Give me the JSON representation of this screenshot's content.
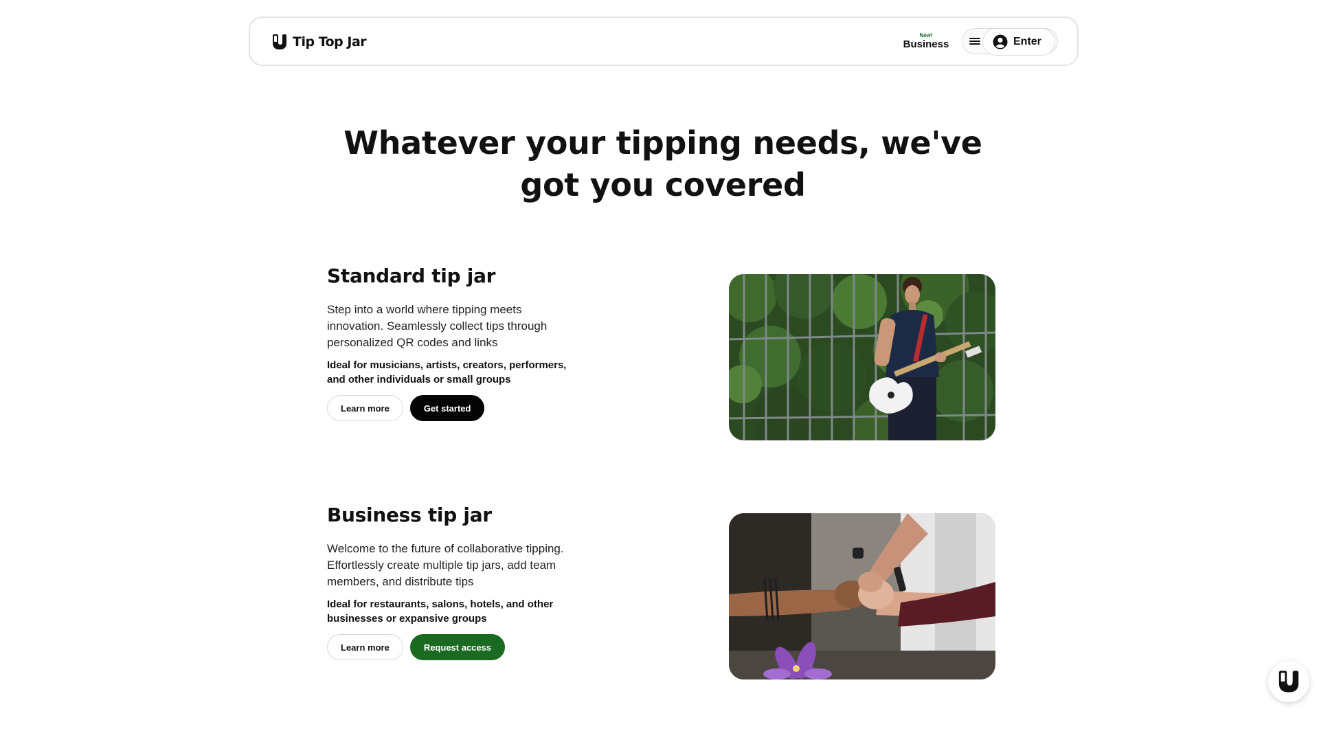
{
  "header": {
    "brand_name": "Tip Top Jar",
    "business_badge": "New!",
    "business_label": "Business",
    "enter_label": "Enter"
  },
  "hero": {
    "title": "Whatever your tipping needs, we've got you covered"
  },
  "sections": [
    {
      "title": "Standard tip jar",
      "description": "Step into a world where tipping meets innovation. Seamlessly collect tips through personalized QR codes and links",
      "ideal_for": "Ideal for musicians, artists, creators, performers, and other individuals or small groups",
      "secondary_button": "Learn more",
      "primary_button": "Get started",
      "primary_color": "#050505",
      "photo": "guitarist-playing-electric-guitar"
    },
    {
      "title": "Business tip jar",
      "description": "Welcome to the future of collaborative tipping. Effortlessly create multiple tip jars, add team members, and distribute tips",
      "ideal_for": "Ideal for restaurants, salons, hotels, and other businesses or expansive groups",
      "secondary_button": "Learn more",
      "primary_button": "Request access",
      "primary_color": "#1b6a22",
      "photo": "team-fist-bump"
    }
  ],
  "icons": {
    "brand": "tip-top-jar-logo-icon",
    "menu": "hamburger-menu-icon",
    "account": "user-account-icon",
    "widget": "tip-top-jar-widget-icon"
  },
  "colors": {
    "accent_green": "#1b6a22",
    "text": "#111111",
    "border": "#e3e3e3"
  }
}
